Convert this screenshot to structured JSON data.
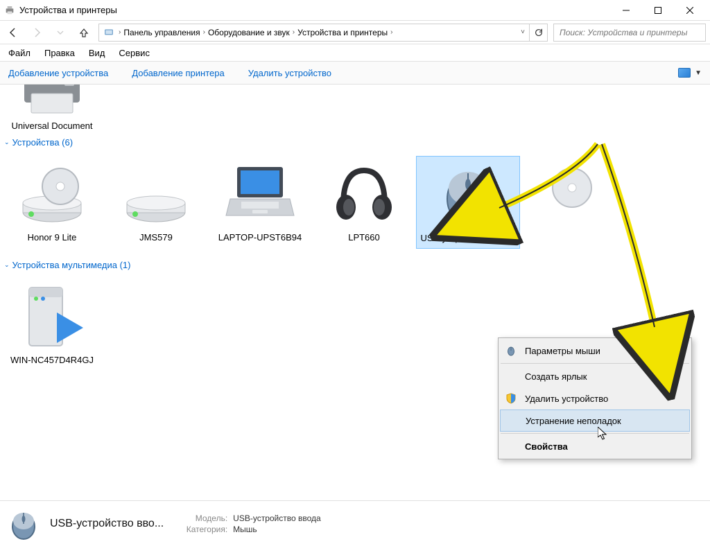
{
  "window": {
    "title": "Устройства и принтеры"
  },
  "breadcrumb": {
    "items": [
      "Панель управления",
      "Оборудование и звук",
      "Устройства и принтеры"
    ]
  },
  "search": {
    "placeholder": "Поиск: Устройства и принтеры"
  },
  "menubar": [
    "Файл",
    "Правка",
    "Вид",
    "Сервис"
  ],
  "toolbar": {
    "add_device": "Добавление устройства",
    "add_printer": "Добавление принтера",
    "remove_device": "Удалить устройство"
  },
  "groups": {
    "printers_item_label": "Universal Document Converter",
    "devices_header": "Устройства (6)",
    "media_header": "Устройства мультимедиа (1)"
  },
  "devices": [
    {
      "label": "Honor 9 Lite"
    },
    {
      "label": "JMS579"
    },
    {
      "label": "LAPTOP-UPST6B94"
    },
    {
      "label": "LPT660"
    },
    {
      "label": "USB-устройство ввода"
    }
  ],
  "media_devices": [
    {
      "label": "WIN-NC457D4R4GJ"
    }
  ],
  "context_menu": {
    "mouse_params": "Параметры мыши",
    "create_shortcut": "Создать ярлык",
    "remove_device": "Удалить устройство",
    "troubleshoot": "Устранение неполадок",
    "properties": "Свойства"
  },
  "details": {
    "title_truncated": "USB-устройство вво...",
    "model_label": "Модель:",
    "model_value": "USB-устройство ввода",
    "category_label": "Категория:",
    "category_value": "Мышь"
  }
}
